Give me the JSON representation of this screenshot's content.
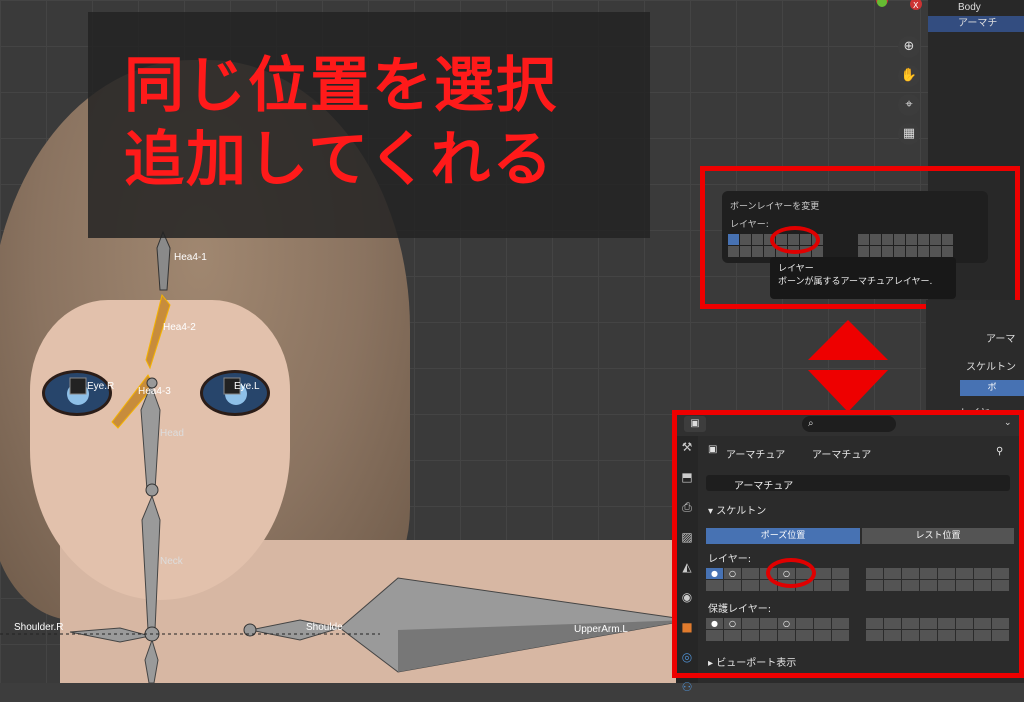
{
  "title_overlay": {
    "line1": "同じ位置を選択",
    "line2": "追加してくれる"
  },
  "bone_labels": {
    "hea4_1": "Hea4-1",
    "hea4_2": "Hea4-2",
    "hea4_3": "Hea4-3",
    "eye_r": "Eye.R",
    "eye_l": "Eye.L",
    "head": "Head",
    "neck": "Neck",
    "shoulder_r": "Shoulder.R",
    "shoulder_l": "Shoulde",
    "upperarm_l": "UpperArm.L"
  },
  "outliner": {
    "row1": "Body",
    "row2": "アーマチ"
  },
  "popup": {
    "title": "ボーンレイヤーを変更",
    "layer_label": "レイヤー:"
  },
  "tooltip": {
    "line1": "レイヤー",
    "line2": "ボーンが属するアーマチュアレイヤー."
  },
  "right_panel": {
    "label1": "アーマ",
    "label2": "スケルトン",
    "label3": "レイヤー:",
    "btn": "ボ"
  },
  "properties": {
    "breadcrumb_1": "アーマチュア",
    "breadcrumb_2": "アーマチュア",
    "data_name": "アーマチュア",
    "section_skeleton": "スケルトン",
    "pose_position": "ポーズ位置",
    "rest_position": "レスト位置",
    "layers_label": "レイヤー:",
    "protected_layers_label": "保護レイヤー:",
    "section_viewport": "ビューポート表示"
  },
  "colors": {
    "accent": "#4772b3",
    "highlight_red": "#ee0000"
  }
}
